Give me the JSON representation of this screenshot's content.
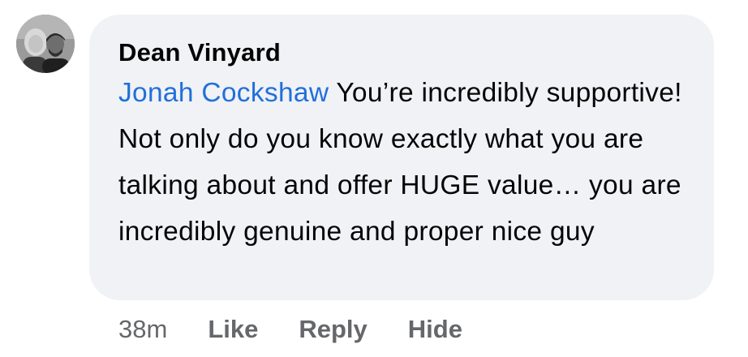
{
  "comment": {
    "author": "Dean Vinyard",
    "mention": "Jonah Cockshaw",
    "text": " You’re incredibly supportive! Not only do you know exactly what you are talking about and offer HUGE value… you are incredibly genuine and proper nice guy"
  },
  "actions": {
    "timestamp": "38m",
    "like_label": "Like",
    "reply_label": "Reply",
    "hide_label": "Hide"
  },
  "colors": {
    "bubble": "#f0f2f5",
    "mention": "#216fdb",
    "meta_text": "#65676b"
  }
}
